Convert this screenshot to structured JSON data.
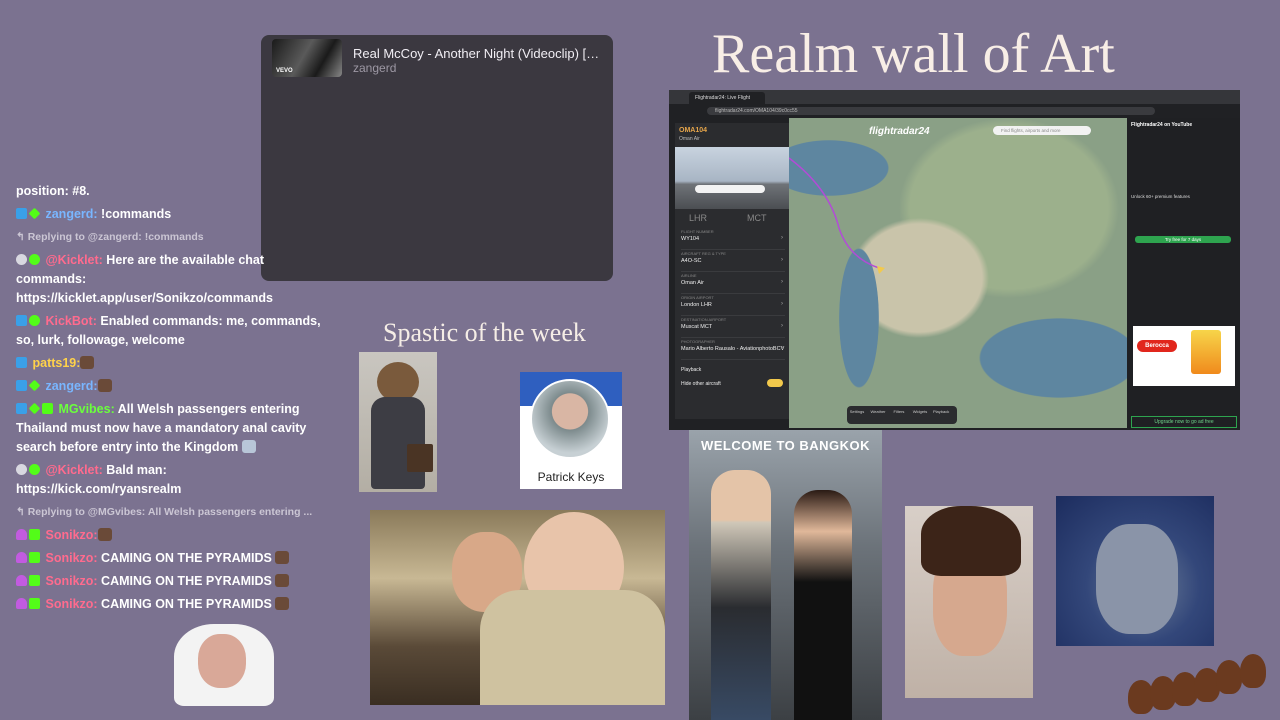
{
  "now_playing": {
    "title": "Real McCoy - Another Night (Videoclip) [Remastered]",
    "artist": "zangerd",
    "art_badge": "VEVO"
  },
  "wall_title": "Realm wall of Art",
  "spastic_title": "Spastic of the week",
  "pk_name": "Patrick Keys",
  "bangkok_sign": "WELCOME TO BANGKOK",
  "chat": {
    "position": "position: #8.",
    "m1_user": "zangerd:",
    "m1_text": " !commands",
    "r1": "↰ Replying to @zangerd: !commands",
    "m2_user": "@Kicklet:",
    "m2_text": " Here are the available chat commands: https://kicklet.app/user/Sonikzo/commands",
    "m3_user": "KickBot:",
    "m3_text": " Enabled commands: me, commands, so, lurk, followage, welcome",
    "m4_user": "patts19:",
    "m5_user": "zangerd:",
    "m6_user": "MGvibes:",
    "m6_text": " All Welsh passengers entering Thailand must now have a mandatory anal cavity search before entry into the Kingdom",
    "m7_user": "@Kicklet:",
    "m7_text": " Bald man: https://kick.com/ryansrealm",
    "r2": "↰ Replying to @MGvibes: All Welsh passengers entering ...",
    "m8_user": "Sonikzo:",
    "m9_user": "Sonikzo:",
    "m9_text": " CAMING ON THE PYRAMIDS",
    "m10_user": "Sonikzo:",
    "m10_text": " CAMING ON THE PYRAMIDS",
    "m11_user": "Sonikzo:",
    "m11_text": " CAMING ON THE PYRAMIDS"
  },
  "flightradar": {
    "tab": "Flightradar24: Live Flight Tracker",
    "url": "flightradar24.com/OMA104/39c0cc55",
    "logo": "flightradar24",
    "search_placeholder": "Find flights, airports and more",
    "flight": "OMA104",
    "airline": "Oman Air",
    "route_from": "LHR",
    "route_to": "MCT",
    "rows": [
      {
        "k": "FLIGHT NUMBER",
        "v": "WY104"
      },
      {
        "k": "AIRCRAFT REG & TYPE",
        "v": "A4O-SC"
      },
      {
        "k": "AIRLINE",
        "v": "Oman Air"
      },
      {
        "k": "ORIGIN AIRPORT",
        "v": "London LHR"
      },
      {
        "k": "DESTINATION AIRPORT",
        "v": "Muscat MCT"
      },
      {
        "k": "PHOTOGRAPHER",
        "v": "Mario Alberto Rausalo - AviationphotoBCV"
      }
    ],
    "playback": "Playback",
    "hide_other": "Hide other aircraft",
    "ad_header": "Flightradar24 on YouTube",
    "ad_unlock": "Unlock 60+ premium features",
    "ad_trial": "Try free for 7 days",
    "ad_brand": "Berocca",
    "ad_upgrade": "Upgrade now to go ad free",
    "bottom": [
      "Settings",
      "Weather",
      "Filters",
      "Widgets",
      "Playback"
    ]
  }
}
